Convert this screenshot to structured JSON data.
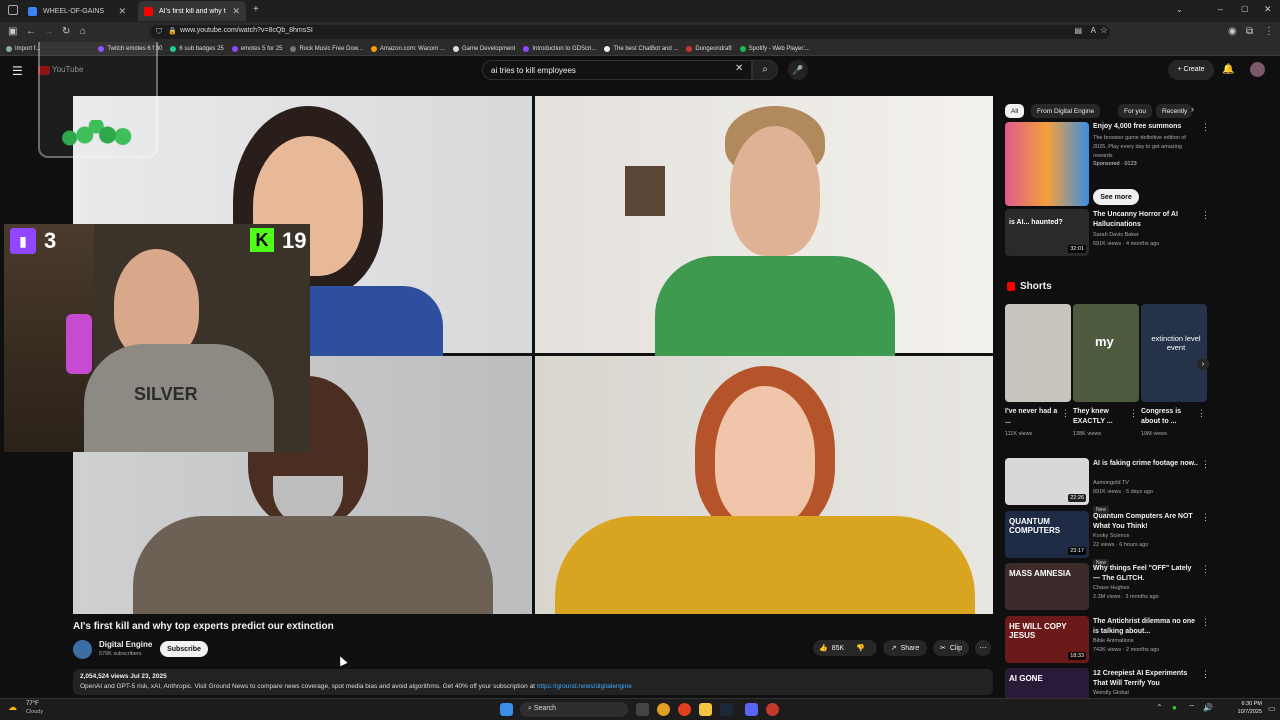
{
  "browser": {
    "tabs": [
      {
        "label": "WHEEL-OF-GAINS",
        "active": false
      },
      {
        "label": "AI's first kill and why top ex",
        "active": true
      }
    ],
    "url": "www.youtube.com/watch?v=8cQb_8hmsSI",
    "bookmarks": [
      "Import f...",
      "Twitch emotes 6 f 30",
      "6 sub badges 25",
      "emotes 5 for 25",
      "Rock Music Free Dow...",
      "Amazon.com: Wacom ...",
      "Game Development",
      "Introduction to GDScri...",
      "The best ChatBot and ...",
      "Dungeondraft",
      "Spotify - Web Player:..."
    ]
  },
  "youtube": {
    "logo": "YouTube",
    "search_value": "ai tries to kill employees",
    "create_label": "Create"
  },
  "overlay": {
    "twitch_count": "3",
    "kick_count": "19",
    "shirt_text": "SILVER"
  },
  "video": {
    "title": "AI's first kill and why top experts predict our extinction",
    "channel": "Digital Engine",
    "subscribers": "576K subscribers",
    "subscribe_label": "Subscribe",
    "likes": "85K",
    "share_label": "Share",
    "clip_label": "Clip",
    "stats": "2,054,524 views  Jul 23, 2025",
    "description": "OpenAI and GPT-5 risk, xAI, Anthropic. Visit Ground News to compare news coverage, spot media bias and avoid algorithms. Get 40% off your subscription at",
    "description_link": "https://ground.news/digitalengine"
  },
  "sidebar": {
    "chips": [
      "All",
      "From Digital Engine",
      "For you",
      "Recently"
    ],
    "ad": {
      "title": "Enjoy 4,000 free summons",
      "body": "The browser game definitive edition of 2025. Play every day to get amazing rewards",
      "sponsored": "Sponsored · 0123",
      "cta": "See more"
    },
    "top_video": {
      "title": "The Uncanny Horror of AI Hallucinations",
      "channel": "Sarah Davis Baker",
      "meta": "691K views · 4 months ago",
      "duration": "32:01",
      "thumb_text": "is AI... haunted?"
    },
    "shorts_heading": "Shorts",
    "shorts": [
      {
        "title": "I've never had a ...",
        "views": "111K views",
        "overlay": ""
      },
      {
        "title": "They knew EXACTLY ...",
        "views": "138K views",
        "overlay": "my"
      },
      {
        "title": "Congress is about to ...",
        "views": "19M views",
        "overlay": "extinction level event"
      }
    ],
    "videos": [
      {
        "title": "AI is faking crime footage now..",
        "channel": "Asmongold TV",
        "meta": "891K views · 5 days ago",
        "badge": "New",
        "duration": "22:26",
        "thumb_text": "",
        "color": "#d8d8d8"
      },
      {
        "title": "Quantum Computers Are NOT What You Think!",
        "channel": "Kooky Science",
        "meta": "22 views · 6 hours ago",
        "badge": "New",
        "duration": "23:17",
        "thumb_text": "QUANTUM COMPUTERS",
        "color": "#1f2a44"
      },
      {
        "title": "Why things Feel \"OFF\" Lately — The GLITCH.",
        "channel": "Chase Hughes",
        "meta": "2.3M views · 3 months ago",
        "badge": "",
        "duration": "",
        "thumb_text": "MASS AMNESIA",
        "color": "#3d2b2b"
      },
      {
        "title": "The Antichrist dilemma no one is talking about...",
        "channel": "Bible Animations",
        "meta": "742K views · 2 months ago",
        "badge": "",
        "duration": "18:33",
        "thumb_text": "HE WILL COPY JESUS",
        "color": "#6b1a1a"
      },
      {
        "title": "12 Creepiest AI Experiments That Will Terrify You",
        "channel": "Weirdly Global",
        "meta": "",
        "badge": "",
        "duration": "",
        "thumb_text": "AI GONE",
        "color": "#2a1a3a"
      }
    ]
  },
  "taskbar": {
    "weather_temp": "77°F",
    "weather_desc": "Cloudy",
    "search_label": "Search",
    "time": "6:30 PM",
    "date": "10/7/2025"
  }
}
